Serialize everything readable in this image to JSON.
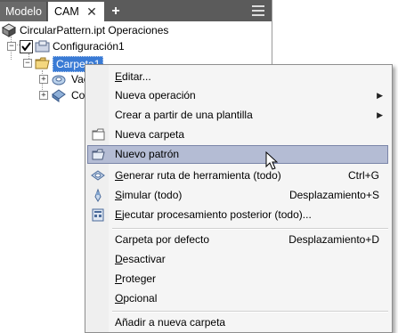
{
  "tabs": {
    "modelo": "Modelo",
    "cam": "CAM",
    "close": "✕",
    "add": "+"
  },
  "tree": {
    "root": "CircularPattern.ipt Operaciones",
    "setup": "Configuración1",
    "folder": "Carpeta1",
    "child1": "Vac",
    "child2": "Co"
  },
  "menu": {
    "items": [
      {
        "pre": "",
        "ul": "E",
        "post": "ditar...",
        "shortcut": "",
        "submenu": false
      },
      {
        "pre": "Nueva operación",
        "ul": "",
        "post": "",
        "shortcut": "",
        "submenu": true
      },
      {
        "pre": "Crear a partir de una plantilla",
        "ul": "",
        "post": "",
        "shortcut": "",
        "submenu": true
      },
      {
        "pre": "Nueva carpeta",
        "ul": "",
        "post": "",
        "shortcut": "",
        "submenu": false
      },
      {
        "pre": "Nuevo patrón",
        "ul": "",
        "post": "",
        "shortcut": "",
        "submenu": false
      },
      {
        "pre": "",
        "ul": "G",
        "post": "enerar ruta de herramienta (todo)",
        "shortcut": "Ctrl+G",
        "submenu": false
      },
      {
        "pre": "",
        "ul": "S",
        "post": "imular (todo)",
        "shortcut": "Desplazamiento+S",
        "submenu": false
      },
      {
        "pre": "",
        "ul": "E",
        "post": "jecutar procesamiento posterior (todo)...",
        "shortcut": "",
        "submenu": false
      },
      {
        "pre": "Carpeta por defecto",
        "ul": "",
        "post": "",
        "shortcut": "Desplazamiento+D",
        "submenu": false
      },
      {
        "pre": "",
        "ul": "D",
        "post": "esactivar",
        "shortcut": "",
        "submenu": false
      },
      {
        "pre": "",
        "ul": "P",
        "post": "roteger",
        "shortcut": "",
        "submenu": false
      },
      {
        "pre": "",
        "ul": "O",
        "post": "pcional",
        "shortcut": "",
        "submenu": false
      },
      {
        "pre": "Añadir a nueva carpeta",
        "ul": "",
        "post": "",
        "shortcut": "",
        "submenu": false
      }
    ]
  },
  "colors": {
    "tabbar": "#5b5b5b",
    "highlight": "#b4bcd4",
    "selection": "#3a7bd5"
  }
}
